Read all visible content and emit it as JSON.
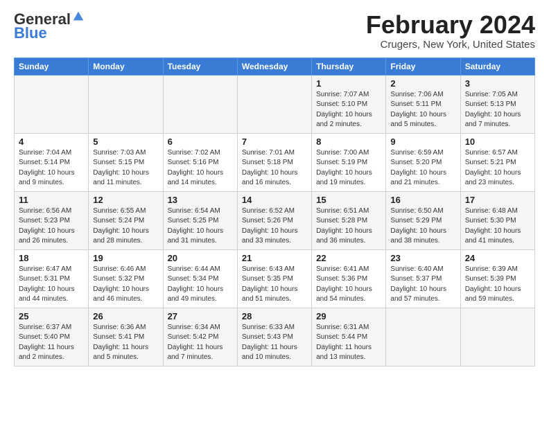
{
  "logo": {
    "general": "General",
    "blue": "Blue"
  },
  "title": "February 2024",
  "subtitle": "Crugers, New York, United States",
  "days_of_week": [
    "Sunday",
    "Monday",
    "Tuesday",
    "Wednesday",
    "Thursday",
    "Friday",
    "Saturday"
  ],
  "weeks": [
    [
      {
        "day": "",
        "content": ""
      },
      {
        "day": "",
        "content": ""
      },
      {
        "day": "",
        "content": ""
      },
      {
        "day": "",
        "content": ""
      },
      {
        "day": "1",
        "content": "Sunrise: 7:07 AM\nSunset: 5:10 PM\nDaylight: 10 hours\nand 2 minutes."
      },
      {
        "day": "2",
        "content": "Sunrise: 7:06 AM\nSunset: 5:11 PM\nDaylight: 10 hours\nand 5 minutes."
      },
      {
        "day": "3",
        "content": "Sunrise: 7:05 AM\nSunset: 5:13 PM\nDaylight: 10 hours\nand 7 minutes."
      }
    ],
    [
      {
        "day": "4",
        "content": "Sunrise: 7:04 AM\nSunset: 5:14 PM\nDaylight: 10 hours\nand 9 minutes."
      },
      {
        "day": "5",
        "content": "Sunrise: 7:03 AM\nSunset: 5:15 PM\nDaylight: 10 hours\nand 11 minutes."
      },
      {
        "day": "6",
        "content": "Sunrise: 7:02 AM\nSunset: 5:16 PM\nDaylight: 10 hours\nand 14 minutes."
      },
      {
        "day": "7",
        "content": "Sunrise: 7:01 AM\nSunset: 5:18 PM\nDaylight: 10 hours\nand 16 minutes."
      },
      {
        "day": "8",
        "content": "Sunrise: 7:00 AM\nSunset: 5:19 PM\nDaylight: 10 hours\nand 19 minutes."
      },
      {
        "day": "9",
        "content": "Sunrise: 6:59 AM\nSunset: 5:20 PM\nDaylight: 10 hours\nand 21 minutes."
      },
      {
        "day": "10",
        "content": "Sunrise: 6:57 AM\nSunset: 5:21 PM\nDaylight: 10 hours\nand 23 minutes."
      }
    ],
    [
      {
        "day": "11",
        "content": "Sunrise: 6:56 AM\nSunset: 5:23 PM\nDaylight: 10 hours\nand 26 minutes."
      },
      {
        "day": "12",
        "content": "Sunrise: 6:55 AM\nSunset: 5:24 PM\nDaylight: 10 hours\nand 28 minutes."
      },
      {
        "day": "13",
        "content": "Sunrise: 6:54 AM\nSunset: 5:25 PM\nDaylight: 10 hours\nand 31 minutes."
      },
      {
        "day": "14",
        "content": "Sunrise: 6:52 AM\nSunset: 5:26 PM\nDaylight: 10 hours\nand 33 minutes."
      },
      {
        "day": "15",
        "content": "Sunrise: 6:51 AM\nSunset: 5:28 PM\nDaylight: 10 hours\nand 36 minutes."
      },
      {
        "day": "16",
        "content": "Sunrise: 6:50 AM\nSunset: 5:29 PM\nDaylight: 10 hours\nand 38 minutes."
      },
      {
        "day": "17",
        "content": "Sunrise: 6:48 AM\nSunset: 5:30 PM\nDaylight: 10 hours\nand 41 minutes."
      }
    ],
    [
      {
        "day": "18",
        "content": "Sunrise: 6:47 AM\nSunset: 5:31 PM\nDaylight: 10 hours\nand 44 minutes."
      },
      {
        "day": "19",
        "content": "Sunrise: 6:46 AM\nSunset: 5:32 PM\nDaylight: 10 hours\nand 46 minutes."
      },
      {
        "day": "20",
        "content": "Sunrise: 6:44 AM\nSunset: 5:34 PM\nDaylight: 10 hours\nand 49 minutes."
      },
      {
        "day": "21",
        "content": "Sunrise: 6:43 AM\nSunset: 5:35 PM\nDaylight: 10 hours\nand 51 minutes."
      },
      {
        "day": "22",
        "content": "Sunrise: 6:41 AM\nSunset: 5:36 PM\nDaylight: 10 hours\nand 54 minutes."
      },
      {
        "day": "23",
        "content": "Sunrise: 6:40 AM\nSunset: 5:37 PM\nDaylight: 10 hours\nand 57 minutes."
      },
      {
        "day": "24",
        "content": "Sunrise: 6:39 AM\nSunset: 5:39 PM\nDaylight: 10 hours\nand 59 minutes."
      }
    ],
    [
      {
        "day": "25",
        "content": "Sunrise: 6:37 AM\nSunset: 5:40 PM\nDaylight: 11 hours\nand 2 minutes."
      },
      {
        "day": "26",
        "content": "Sunrise: 6:36 AM\nSunset: 5:41 PM\nDaylight: 11 hours\nand 5 minutes."
      },
      {
        "day": "27",
        "content": "Sunrise: 6:34 AM\nSunset: 5:42 PM\nDaylight: 11 hours\nand 7 minutes."
      },
      {
        "day": "28",
        "content": "Sunrise: 6:33 AM\nSunset: 5:43 PM\nDaylight: 11 hours\nand 10 minutes."
      },
      {
        "day": "29",
        "content": "Sunrise: 6:31 AM\nSunset: 5:44 PM\nDaylight: 11 hours\nand 13 minutes."
      },
      {
        "day": "",
        "content": ""
      },
      {
        "day": "",
        "content": ""
      }
    ]
  ]
}
